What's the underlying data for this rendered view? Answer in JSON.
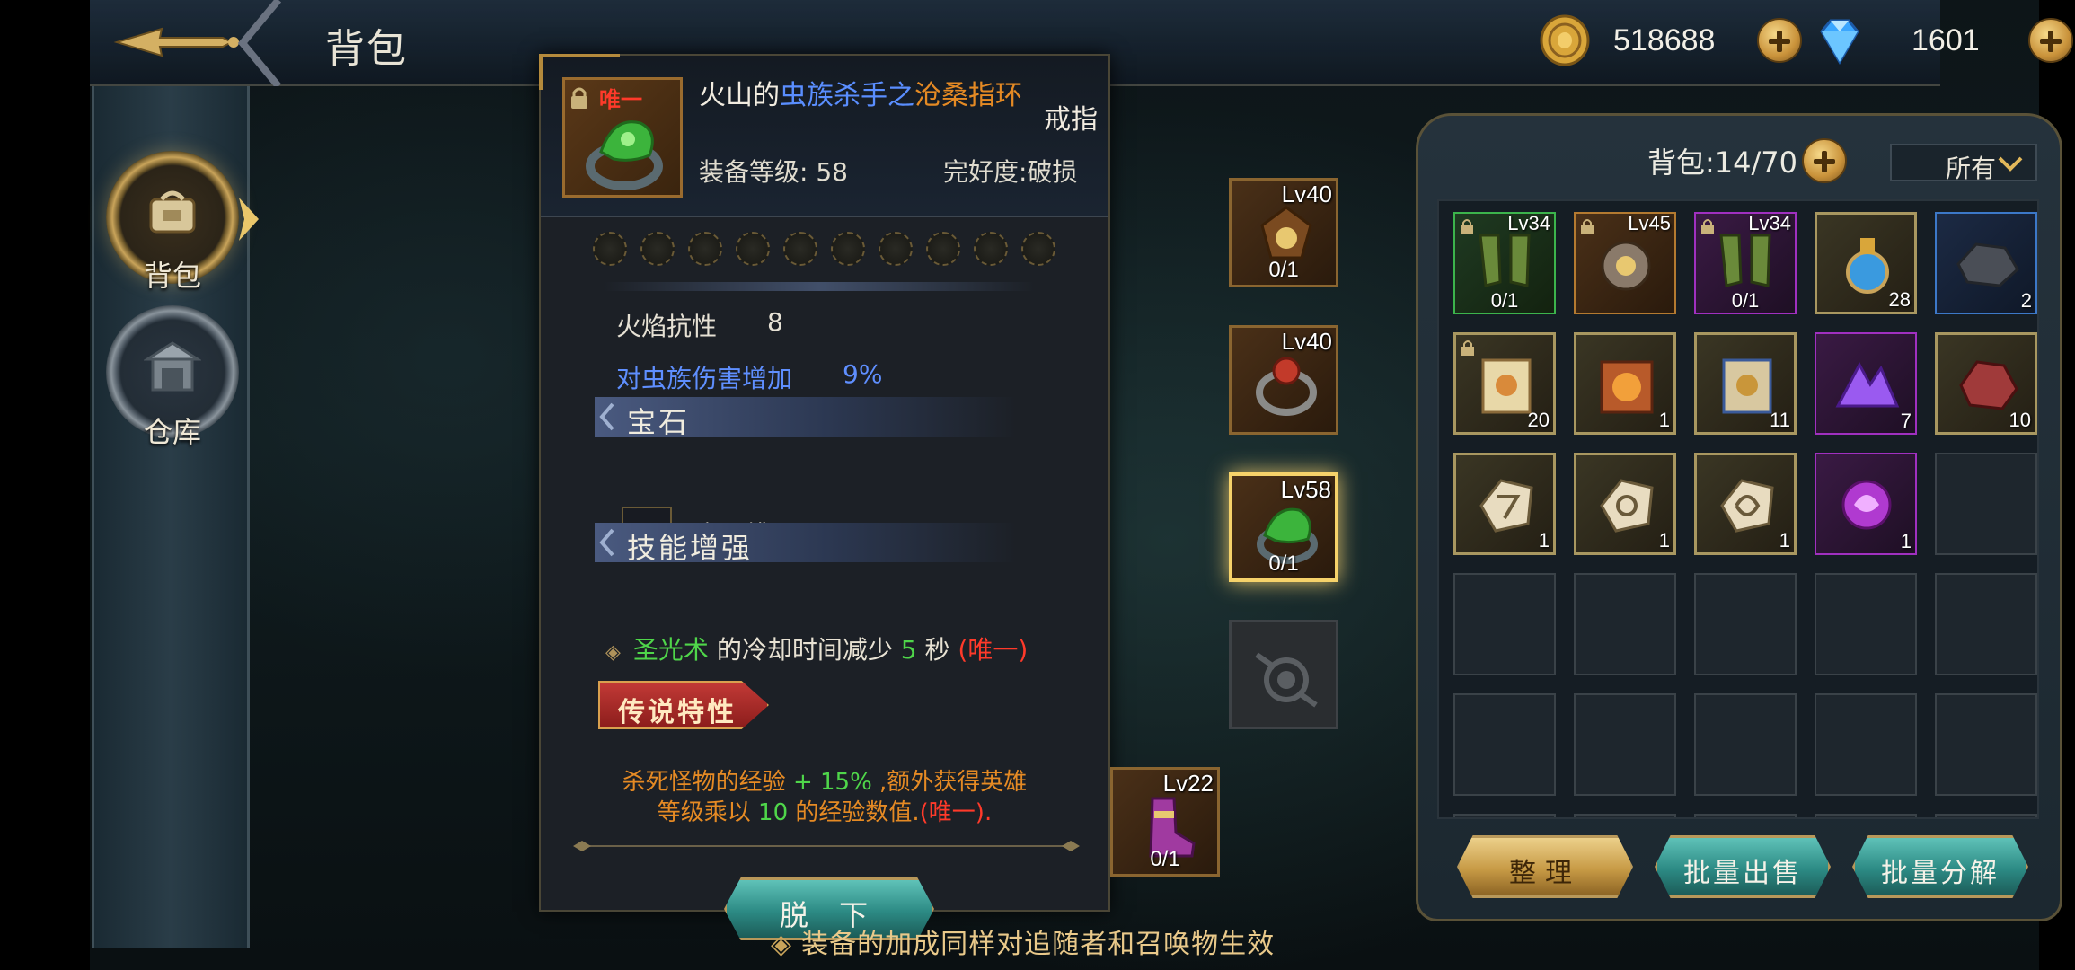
{
  "header": {
    "title": "背包",
    "gold": "518688",
    "gems": "1601"
  },
  "sidebar": {
    "items": [
      {
        "label": "背包",
        "active": true
      },
      {
        "label": "仓库",
        "active": false
      }
    ]
  },
  "item_detail": {
    "unique_tag": "唯一",
    "name_prefix": "火山的",
    "name_blue": "虫族杀手之",
    "name_orange": "沧桑指环",
    "name_orange_line2": "环",
    "type": "戒指",
    "level": "装备等级: 58",
    "durability": "完好度:破损",
    "attr_fire_label": "火焰抗性",
    "attr_fire_value": "8",
    "attr_bug_label": "对虫族伤害增加",
    "attr_bug_value": "9%",
    "gem_section": "宝石",
    "gem_slot_label": "空凹槽",
    "skill_section": "技能增强",
    "skill_name": "圣光术",
    "skill_mid": " 的冷却时间减少 ",
    "skill_value": "5",
    "skill_unit": " 秒 ",
    "skill_unique": "(唯一)",
    "legend_label": "传说特性",
    "legend_l1a": "杀死怪物的经验 ",
    "legend_l1b": "+ 15%",
    "legend_l1c": " ,额外获得英雄",
    "legend_l2a": "等级乘以 ",
    "legend_l2b": "10",
    "legend_l2c": " 的经验数值.",
    "legend_l2d": "(唯一).",
    "unequip_label": "脱 下"
  },
  "equipped": [
    {
      "level": "Lv40",
      "count": "0/1"
    },
    {
      "level": "Lv40",
      "count": ""
    },
    {
      "level": "Lv58",
      "count": "0/1"
    },
    {
      "level": "",
      "count": ""
    },
    {
      "level": "Lv22",
      "count": "0/1"
    }
  ],
  "bottom_note": "装备的加成同样对追随者和召唤物生效",
  "inventory": {
    "title": "背包:14/70",
    "filter": "所有",
    "cells": [
      {
        "level": "Lv34",
        "count": "0/1"
      },
      {
        "level": "Lv45",
        "count": ""
      },
      {
        "level": "Lv34",
        "count": "0/1"
      },
      {
        "level": "",
        "count": "28"
      },
      {
        "level": "",
        "count": "2"
      },
      {
        "level": "",
        "count": "20"
      },
      {
        "level": "",
        "count": "1"
      },
      {
        "level": "",
        "count": "11"
      },
      {
        "level": "",
        "count": "7"
      },
      {
        "level": "",
        "count": "10"
      },
      {
        "level": "",
        "count": "1"
      },
      {
        "level": "",
        "count": "1"
      },
      {
        "level": "",
        "count": "1"
      },
      {
        "level": "",
        "count": "1"
      }
    ],
    "sort_label": "整理",
    "sell_label": "批量出售",
    "decompose_label": "批量分解"
  }
}
